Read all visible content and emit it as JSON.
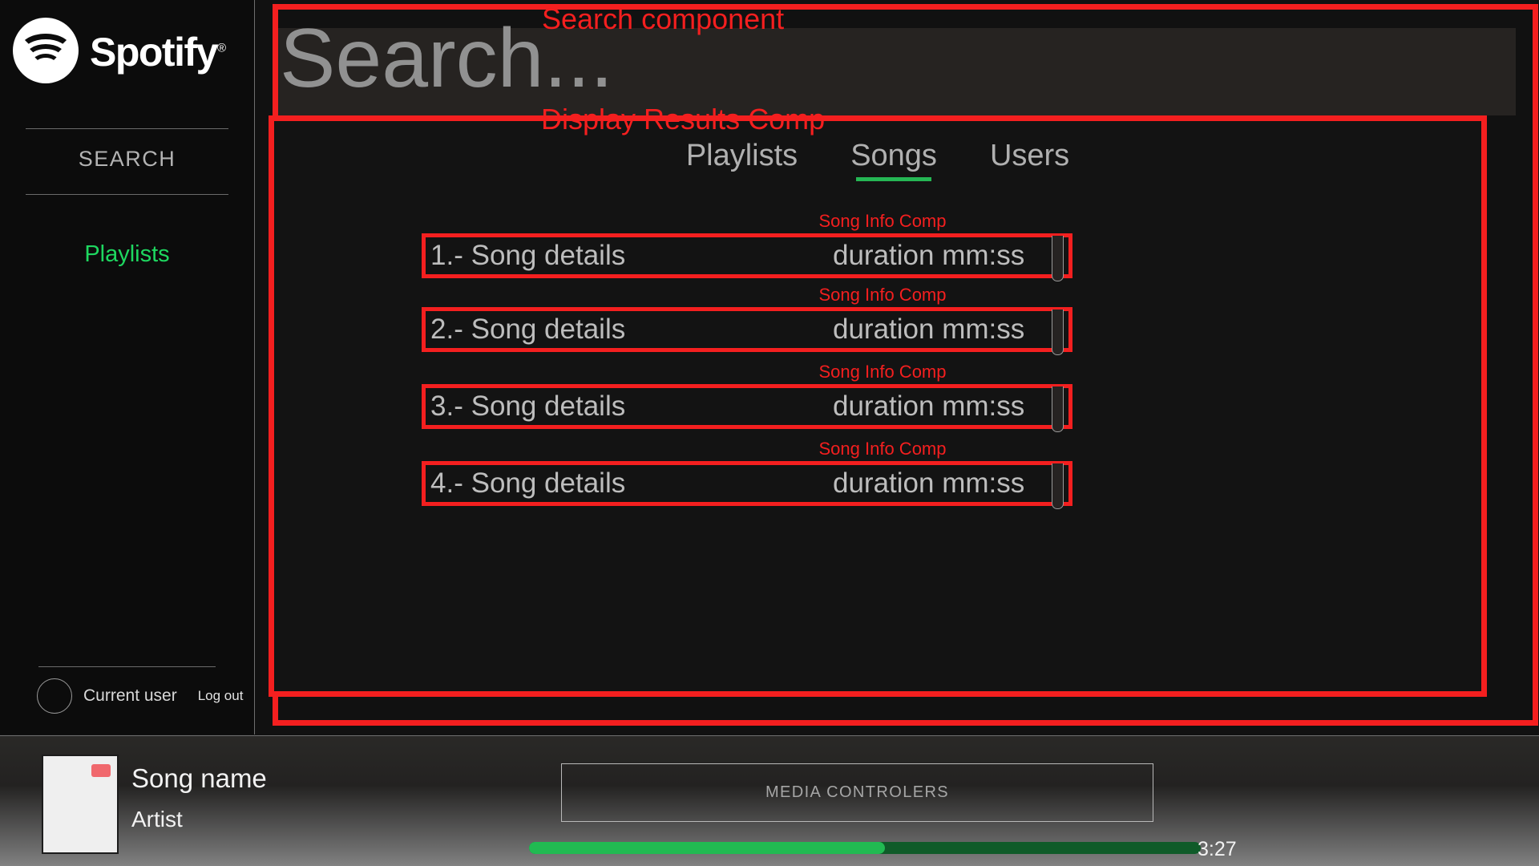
{
  "brand": {
    "name": "Spotify",
    "registered_mark": "®",
    "logo_icon": "spotify-logo-icon",
    "accent_green": "#1ed760"
  },
  "sidebar": {
    "nav": [
      {
        "label": "SEARCH",
        "id": "search",
        "active": false
      },
      {
        "label": "Playlists",
        "id": "playlists",
        "active": true
      }
    ],
    "user": {
      "avatar_icon": "user-avatar-icon",
      "name": "Current user",
      "logout_label": "Log out"
    }
  },
  "annotations": {
    "search_component": "Search component",
    "display_results_component": "Display Results Comp",
    "song_info_component": "Song Info Comp",
    "color": "#f41f1f"
  },
  "search": {
    "value": "",
    "placeholder": "Search..."
  },
  "results": {
    "tabs": [
      {
        "label": "Playlists",
        "active": false
      },
      {
        "label": "Songs",
        "active": true
      },
      {
        "label": "Users",
        "active": false
      }
    ],
    "active_tab_underline_color": "#25b754",
    "songs": [
      {
        "index": "1.-",
        "title": "Song details",
        "duration": "duration mm:ss"
      },
      {
        "index": "2.-",
        "title": "Song details",
        "duration": "duration mm:ss"
      },
      {
        "index": "3.-",
        "title": "Song details",
        "duration": "duration mm:ss"
      },
      {
        "index": "4.-",
        "title": "Song details",
        "duration": "duration mm:ss"
      }
    ]
  },
  "player": {
    "album_art_icon": "album-art-placeholder-icon",
    "song_name": "Song name",
    "artist": "Artist",
    "media_controls_label": "MEDIA CONTROLERS",
    "time": "3:27",
    "progress_percent": 53,
    "progress_color": "#21ba52",
    "progress_track_color": "#0f5b29"
  }
}
